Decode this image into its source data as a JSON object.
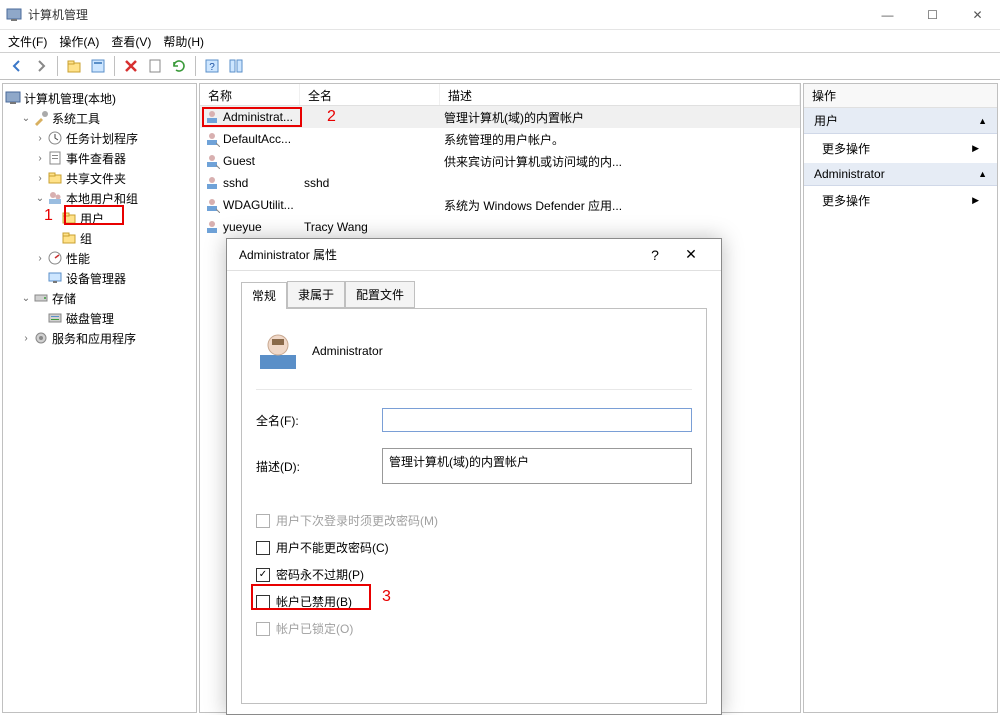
{
  "window": {
    "title": "计算机管理",
    "minimize": "—",
    "maximize": "☐",
    "close": "✕"
  },
  "menu": {
    "file": "文件(F)",
    "action": "操作(A)",
    "view": "查看(V)",
    "help": "帮助(H)"
  },
  "tree": {
    "root": "计算机管理(本地)",
    "system_tools": "系统工具",
    "task_scheduler": "任务计划程序",
    "event_viewer": "事件查看器",
    "shared_folders": "共享文件夹",
    "local_users_groups": "本地用户和组",
    "users": "用户",
    "groups": "组",
    "performance": "性能",
    "device_manager": "设备管理器",
    "storage": "存储",
    "disk_management": "磁盘管理",
    "services_apps": "服务和应用程序"
  },
  "list": {
    "columns": {
      "name": "名称",
      "fullname": "全名",
      "desc": "描述"
    },
    "rows": [
      {
        "name": "Administrat...",
        "fullname": "",
        "desc": "管理计算机(域)的内置帐户"
      },
      {
        "name": "DefaultAcc...",
        "fullname": "",
        "desc": "系统管理的用户帐户。"
      },
      {
        "name": "Guest",
        "fullname": "",
        "desc": "供来宾访问计算机或访问域的内..."
      },
      {
        "name": "sshd",
        "fullname": "sshd",
        "desc": ""
      },
      {
        "name": "WDAGUtilit...",
        "fullname": "",
        "desc": "系统为 Windows Defender 应用..."
      },
      {
        "name": "yueyue",
        "fullname": "Tracy Wang",
        "desc": ""
      }
    ]
  },
  "actions_pane": {
    "header": "操作",
    "sections": [
      {
        "title": "用户",
        "items": [
          "更多操作"
        ]
      },
      {
        "title": "Administrator",
        "items": [
          "更多操作"
        ]
      }
    ]
  },
  "dialog": {
    "title": "Administrator 属性",
    "tabs": {
      "general": "常规",
      "memberof": "隶属于",
      "profile": "配置文件"
    },
    "username": "Administrator",
    "fullname_label": "全名(F):",
    "fullname_value": "",
    "desc_label": "描述(D):",
    "desc_value": "管理计算机(域)的内置帐户",
    "chk_must_change": "用户下次登录时须更改密码(M)",
    "chk_cannot_change": "用户不能更改密码(C)",
    "chk_never_expire": "密码永不过期(P)",
    "chk_disabled": "帐户已禁用(B)",
    "chk_locked": "帐户已锁定(O)"
  },
  "annotations": {
    "n1": "1",
    "n2": "2",
    "n3": "3"
  }
}
